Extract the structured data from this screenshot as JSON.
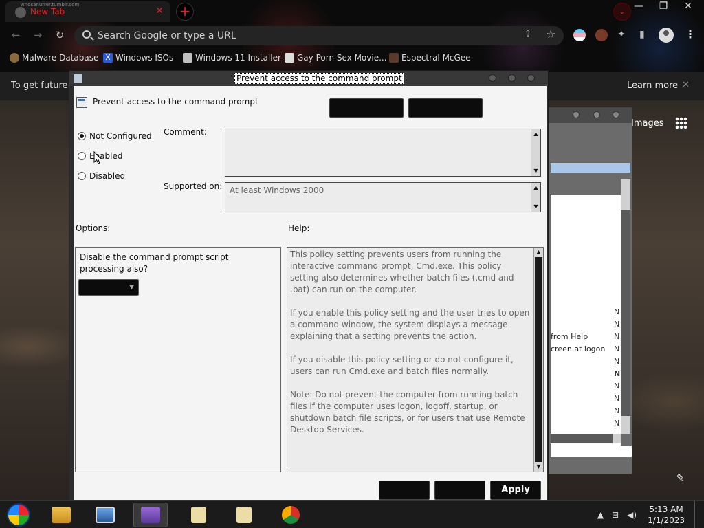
{
  "browser": {
    "tab_title": "New Tab",
    "tab_tiny_text": "whosanurrer.tumblr.com",
    "newtab_glyph": "+",
    "tab_close_glyph": "✕",
    "profile_glyph": "⌄",
    "window_controls": [
      "—",
      "❐",
      "✕"
    ],
    "omnibox_placeholder": "Search Google or type a URL",
    "nav": {
      "back": "←",
      "forward": "→",
      "reload": "↻",
      "home": "⌂"
    },
    "bookmarks": [
      {
        "label": "Malware Database",
        "icon": "person-icon",
        "color": "#8a6a3a"
      },
      {
        "label": "Windows ISOs",
        "icon": "x-icon",
        "color": "#2a5bd7"
      },
      {
        "label": "Windows 11 Installer",
        "icon": "window-icon",
        "color": "#c0c0c0"
      },
      {
        "label": "Gay Porn Sex Movie...",
        "icon": "bookmark-icon",
        "color": "#ddd"
      },
      {
        "label": "Espectral McGee",
        "icon": "bookmark-icon",
        "color": "#5a3a2a"
      }
    ],
    "share_glyph": "⇪",
    "star_glyph": "☆",
    "menu_glyph": "⋮"
  },
  "page": {
    "info_text": "To get future G",
    "learn_more": "Learn more",
    "info_close": "✕",
    "images_link": "Images",
    "pencil_glyph": "✎"
  },
  "bg_window": {
    "rows": [
      "from Help",
      "creen at logon"
    ],
    "n_letters": [
      "N",
      "N",
      "N",
      "N",
      "N",
      "N",
      "N",
      "N",
      "N",
      "N",
      "N",
      "N"
    ]
  },
  "dialog": {
    "title": "Prevent access to the command prompt",
    "policy_name": "Prevent access to the command prompt",
    "state_options": [
      {
        "label": "Not Configured",
        "checked": true
      },
      {
        "label": "Enabled",
        "checked": false
      },
      {
        "label": "Disabled",
        "checked": false
      }
    ],
    "comment_label": "Comment:",
    "comment_value": "",
    "supported_on_label": "Supported on:",
    "supported_on_value": "At least Windows 2000",
    "options_label": "Options:",
    "help_label": "Help:",
    "option_text": "Disable the command prompt script processing also?",
    "option_select_value": "",
    "help_paragraphs": [
      "This policy setting prevents users from running the interactive command prompt, Cmd.exe.  This policy setting also determines whether batch files (.cmd and .bat) can run on the computer.",
      "If you enable this policy setting and the user tries to open a command window, the system displays a message explaining that a setting prevents the action.",
      "If you disable this policy setting or do not configure it, users can run Cmd.exe and batch files normally.",
      "Note: Do not prevent the computer from running batch files if the computer uses logon, logoff, startup, or shutdown batch file scripts, or for users that use Remote Desktop Services."
    ],
    "footer_buttons": [
      "",
      "",
      "Apply"
    ],
    "scroll_up": "▲",
    "scroll_down": "▼"
  },
  "taskbar": {
    "items": [
      {
        "name": "explorer-icon",
        "color": "#d9a534"
      },
      {
        "name": "photo-viewer-icon",
        "color": "#5a8ac8"
      },
      {
        "name": "users-icon",
        "color": "#8a5ac8"
      },
      {
        "name": "notepad-icon",
        "color": "#e8d8a0"
      },
      {
        "name": "notepad-icon",
        "color": "#e8d8a0"
      },
      {
        "name": "chrome-icon",
        "color": "#d93025"
      }
    ],
    "tray_up": "▲",
    "network_glyph": "🖧",
    "volume_glyph": "🔊",
    "time": "5:13 AM",
    "date": "1/1/2023"
  }
}
